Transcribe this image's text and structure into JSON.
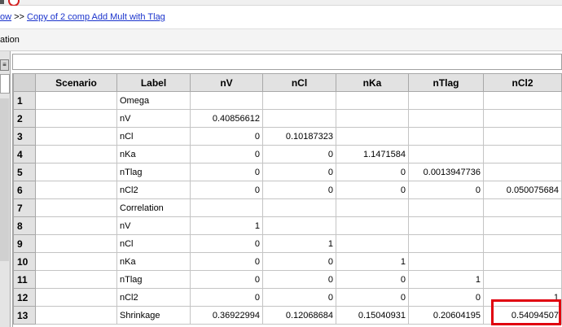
{
  "breadcrumb": {
    "prev_fragment": "ow",
    "separator": " >> ",
    "current": "Copy of 2 comp Add Mult with Tlag"
  },
  "page": {
    "title_fragment": "ation"
  },
  "left_panel": {
    "button_glyph": "≡"
  },
  "formula_bar": {
    "value": ""
  },
  "grid": {
    "columns": [
      "Scenario",
      "Label",
      "nV",
      "nCl",
      "nKa",
      "nTlag",
      "nCl2"
    ],
    "rows": [
      {
        "n": "1",
        "scenario": "",
        "label": "Omega",
        "nV": "",
        "nCl": "",
        "nKa": "",
        "nTlag": "",
        "nCl2": ""
      },
      {
        "n": "2",
        "scenario": "",
        "label": "nV",
        "nV": "0.40856612",
        "nCl": "",
        "nKa": "",
        "nTlag": "",
        "nCl2": ""
      },
      {
        "n": "3",
        "scenario": "",
        "label": "nCl",
        "nV": "0",
        "nCl": "0.10187323",
        "nKa": "",
        "nTlag": "",
        "nCl2": ""
      },
      {
        "n": "4",
        "scenario": "",
        "label": "nKa",
        "nV": "0",
        "nCl": "0",
        "nKa": "1.1471584",
        "nTlag": "",
        "nCl2": ""
      },
      {
        "n": "5",
        "scenario": "",
        "label": "nTlag",
        "nV": "0",
        "nCl": "0",
        "nKa": "0",
        "nTlag": "0.0013947736",
        "nCl2": ""
      },
      {
        "n": "6",
        "scenario": "",
        "label": "nCl2",
        "nV": "0",
        "nCl": "0",
        "nKa": "0",
        "nTlag": "0",
        "nCl2": "0.050075684"
      },
      {
        "n": "7",
        "scenario": "",
        "label": "Correlation",
        "nV": "",
        "nCl": "",
        "nKa": "",
        "nTlag": "",
        "nCl2": ""
      },
      {
        "n": "8",
        "scenario": "",
        "label": "nV",
        "nV": "1",
        "nCl": "",
        "nKa": "",
        "nTlag": "",
        "nCl2": ""
      },
      {
        "n": "9",
        "scenario": "",
        "label": "nCl",
        "nV": "0",
        "nCl": "1",
        "nKa": "",
        "nTlag": "",
        "nCl2": ""
      },
      {
        "n": "10",
        "scenario": "",
        "label": "nKa",
        "nV": "0",
        "nCl": "0",
        "nKa": "1",
        "nTlag": "",
        "nCl2": ""
      },
      {
        "n": "11",
        "scenario": "",
        "label": "nTlag",
        "nV": "0",
        "nCl": "0",
        "nKa": "0",
        "nTlag": "1",
        "nCl2": ""
      },
      {
        "n": "12",
        "scenario": "",
        "label": "nCl2",
        "nV": "0",
        "nCl": "0",
        "nKa": "0",
        "nTlag": "0",
        "nCl2": "1"
      },
      {
        "n": "13",
        "scenario": "",
        "label": "Shrinkage",
        "nV": "0.36922994",
        "nCl": "0.12068684",
        "nKa": "0.15040931",
        "nTlag": "0.20604195",
        "nCl2": "0.54094507"
      }
    ]
  },
  "colors": {
    "highlight": "#e0000f",
    "link": "#1a33cc",
    "header_bg": "#e2e2e2"
  }
}
